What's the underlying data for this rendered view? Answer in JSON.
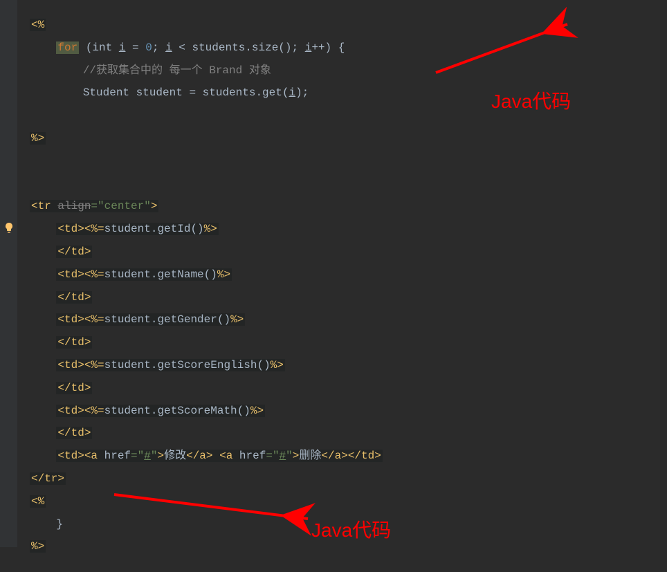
{
  "annotations": {
    "label1": "Java代码",
    "label2": "Java代码"
  },
  "code": {
    "l1": "<%",
    "l2_for": "for",
    "l2_rest": " (int ",
    "l2_i": "i",
    "l2_eq": " = ",
    "l2_zero": "0",
    "l2_semi": "; ",
    "l2_i2": "i",
    "l2_lt": " < students.size(); ",
    "l2_i3": "i",
    "l2_inc": "++) {",
    "l3_comment": "//获取集合中的 每一个 Brand 对象",
    "l4": "Student student = students.get(",
    "l4_i": "i",
    "l4_end": ");",
    "l5": "%>",
    "l7_tr": "<tr ",
    "l7_align": "align",
    "l7_eq": "=",
    "l7_val": "\"center\"",
    "l7_close": ">",
    "l8_td": "<td>",
    "l8_exp_open": "<%=",
    "l8_method": "student.getId()",
    "l8_exp_close": "%>",
    "l9_tdclose": "</td>",
    "l10_method": "student.getName()",
    "l12_method": "student.getGender()",
    "l14_method": "student.getScoreEnglish()",
    "l16_method": "student.getScoreMath()",
    "l18_a": "<a ",
    "l18_href": "href",
    "l18_hash": "\"#\"",
    "l18_mod": "修改",
    "l18_aclose": "</a>",
    "l18_del": "删除",
    "l18_tdclose": "</td>",
    "l19_trclose": "</tr>",
    "l20": "<%",
    "l21_brace": "}",
    "l22": "%>"
  }
}
